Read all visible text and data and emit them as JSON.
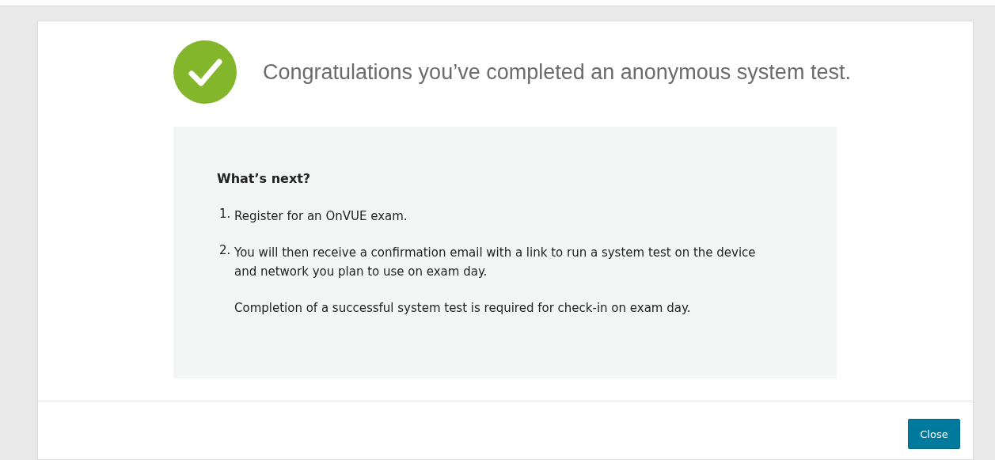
{
  "modal": {
    "title": "Congratulations you’ve completed an anonymous system test.",
    "panel": {
      "heading": "What’s next?",
      "steps": [
        {
          "number": "1.",
          "paragraphs": [
            "Register for an OnVUE exam."
          ]
        },
        {
          "number": "2.",
          "paragraphs": [
            "You will then receive a confirmation email with a link to run a system test on the device and network you plan to use on exam day.",
            "Completion of a successful system test is required for check-in on exam day."
          ]
        }
      ]
    },
    "buttons": [
      "Close"
    ]
  }
}
